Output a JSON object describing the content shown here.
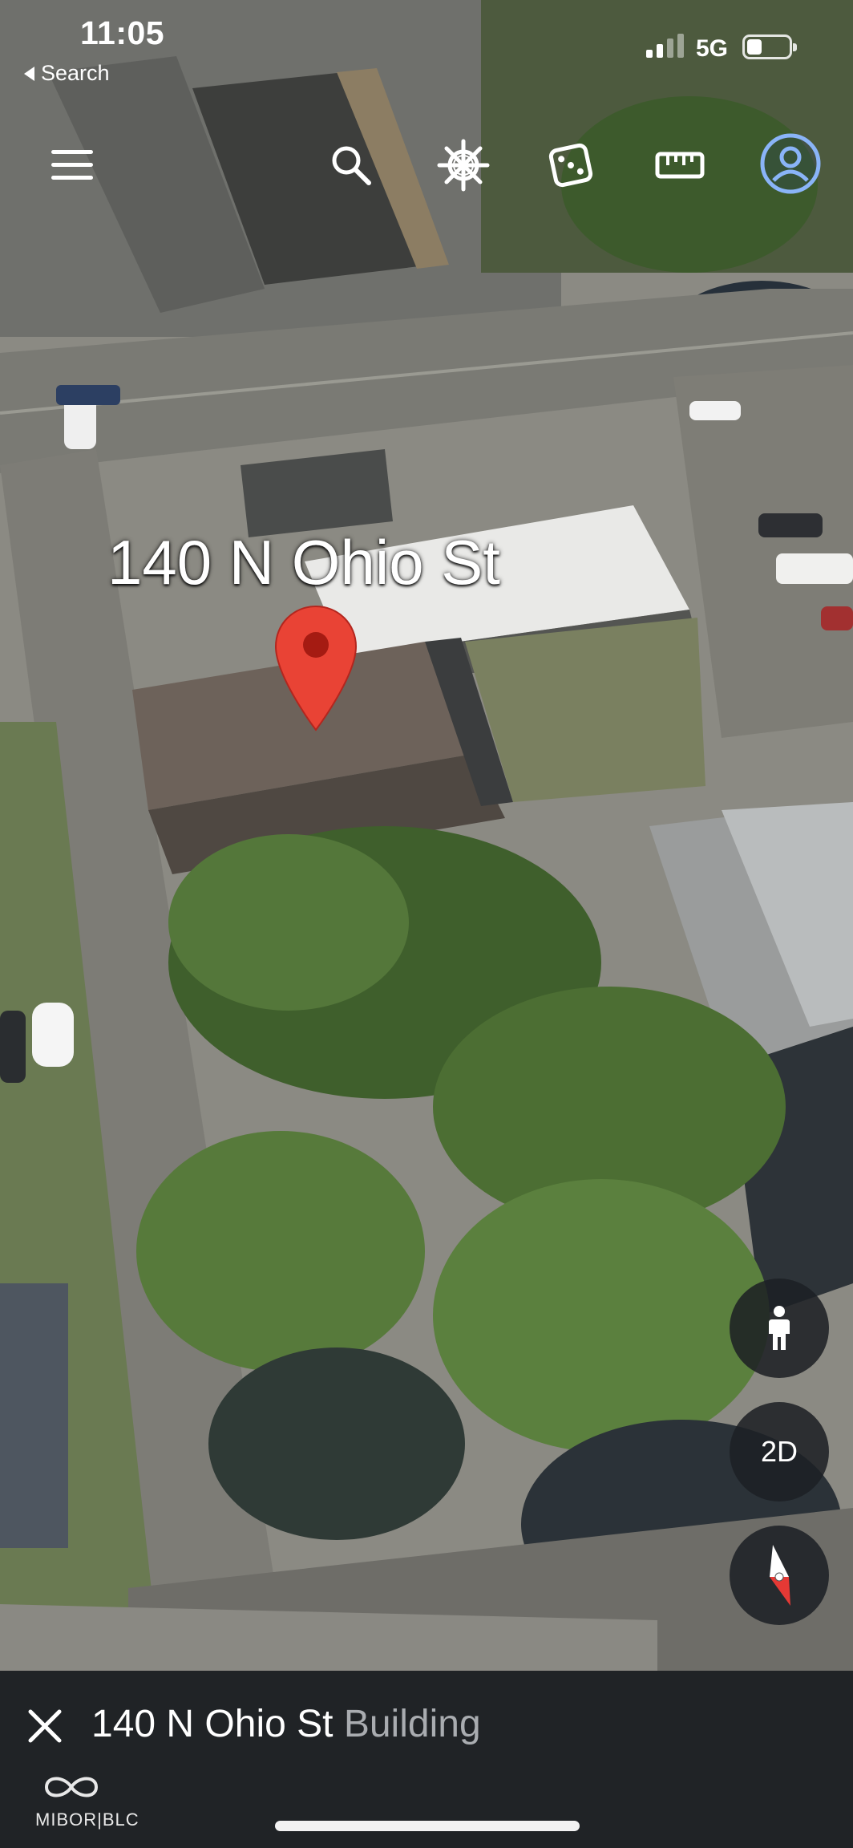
{
  "status_bar": {
    "time": "11:05",
    "back_label": "Search",
    "network": "5G",
    "battery_level": 0.35
  },
  "toolbar": {
    "items": [
      {
        "icon": "menu-icon"
      },
      {
        "icon": "search-icon"
      },
      {
        "icon": "voyager-wheel-icon"
      },
      {
        "icon": "dice-icon"
      },
      {
        "icon": "ruler-icon"
      },
      {
        "icon": "account-icon"
      }
    ]
  },
  "map": {
    "place_label": "140 N Ohio St",
    "pin_color": "#e94335"
  },
  "controls": {
    "street_view_icon": "pegman-icon",
    "view_mode": "2D",
    "compass_icon": "compass-icon"
  },
  "place_panel": {
    "title": "140 N Ohio St",
    "subtitle": "Building",
    "logo_text": "MIBOR|BLC"
  }
}
